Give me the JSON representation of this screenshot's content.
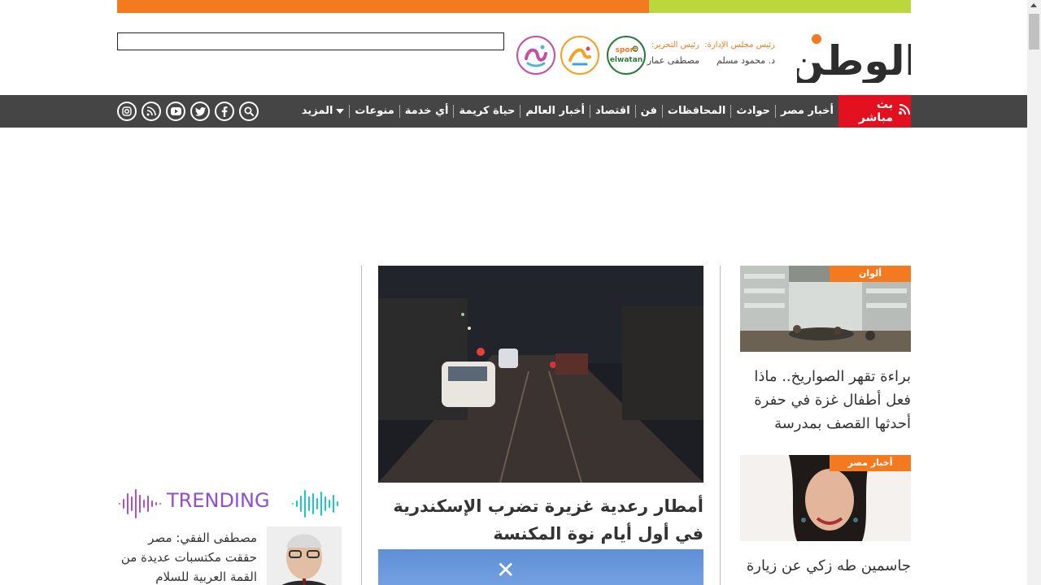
{
  "header": {
    "logo_text": "الوطن",
    "board_role": "رئيس مجلس الإدارة:",
    "board_name": "د. محمود مسلم",
    "editor_role": "رئيس التحرير:",
    "editor_name": "مصطفى عمار",
    "partner_logos": [
      "elwatan sport",
      "ألوان",
      "هي"
    ]
  },
  "nav": {
    "live_label": "بث مباشر",
    "items": [
      "أخبار مصر",
      "حوادث",
      "المحافظات",
      "فن",
      "اقتصاد",
      "أخبار العالم",
      "حياة كريمة",
      "أي خدمة",
      "منوعات"
    ],
    "more_label": "المزيد",
    "socials": [
      "search-icon",
      "facebook-icon",
      "twitter-icon",
      "youtube-icon",
      "rss-icon",
      "instagram-icon"
    ]
  },
  "side_stories": [
    {
      "tag": "ألوان",
      "title": "براءة تقهر الصواريخ.. ماذا فعل أطفال غزة في حفرة أحدثها القصف بمدرسة"
    },
    {
      "tag": "أخبار مصر",
      "title": "جاسمين طه زكي عن زيارة"
    }
  ],
  "main_story": {
    "title": "أمطار رعدية غزيرة تضرب الإسكندرية في أول أيام نوة المكنسة"
  },
  "trending": {
    "label": "TRENDING",
    "story_title": "مصطفى الفقي: مصر حققت مكتسبات عديدة من القمة العربية للسلام"
  },
  "colors": {
    "orange": "#f47a20",
    "green": "#bcd63d",
    "nav_bg": "#454545",
    "live_red": "#e3101f"
  }
}
